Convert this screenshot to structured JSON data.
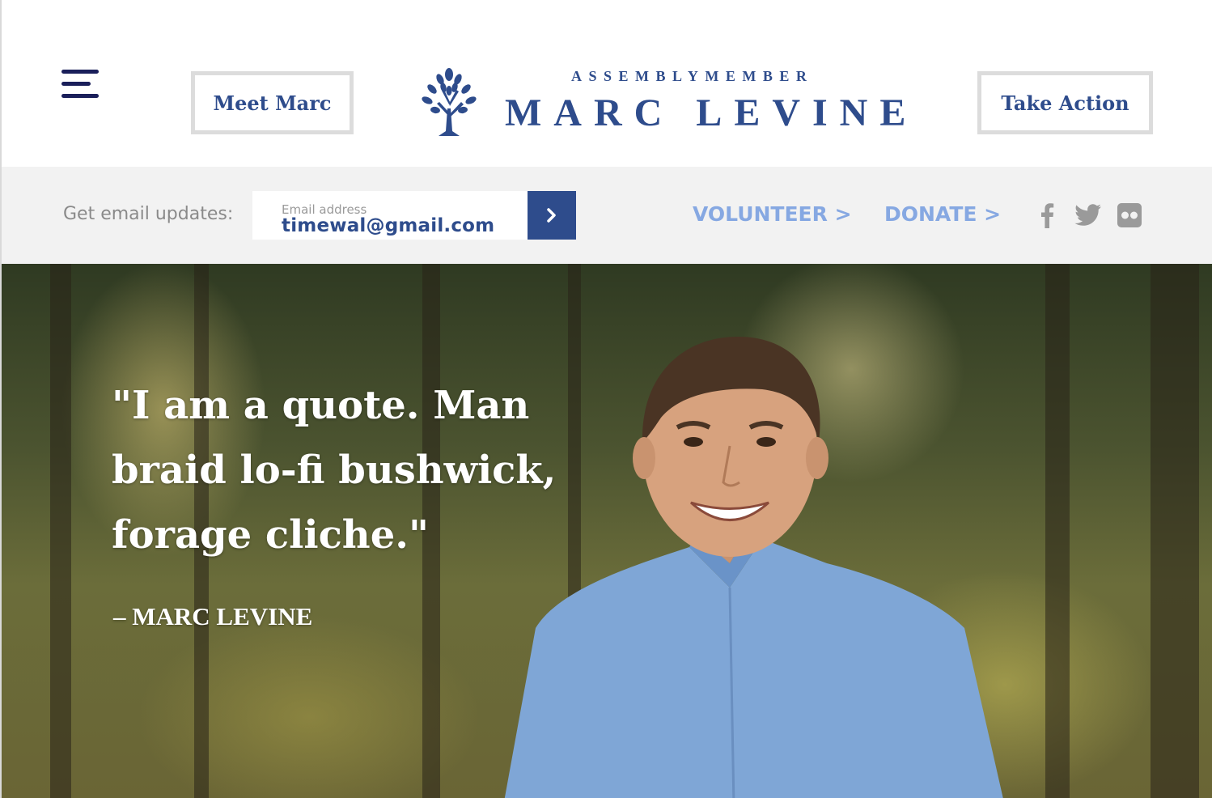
{
  "header": {
    "menu_icon": "hamburger-menu-icon",
    "meet_label": "Meet Marc",
    "take_action_label": "Take Action",
    "logo": {
      "title": "ASSEMBLYMEMBER",
      "name": "MARC LEVINE",
      "icon": "tree-icon"
    }
  },
  "subbar": {
    "email_label": "Get email updates:",
    "email_placeholder": "Email address",
    "email_value": "timewal@gmail.com",
    "submit_icon": "chevron-right-icon",
    "volunteer_label": "VOLUNTEER >",
    "donate_label": "DONATE >",
    "social": [
      "facebook-icon",
      "twitter-icon",
      "flickr-icon"
    ]
  },
  "hero": {
    "quote": "\"I am a quote. Man braid lo-fi bushwick, forage cliche.\"",
    "attribution": "– MARC LEVINE"
  },
  "colors": {
    "brand_blue": "#2e4c8c",
    "link_blue": "#86a8e2",
    "subbar_bg": "#f2f2f2",
    "nav_border": "#dcdcdc"
  }
}
